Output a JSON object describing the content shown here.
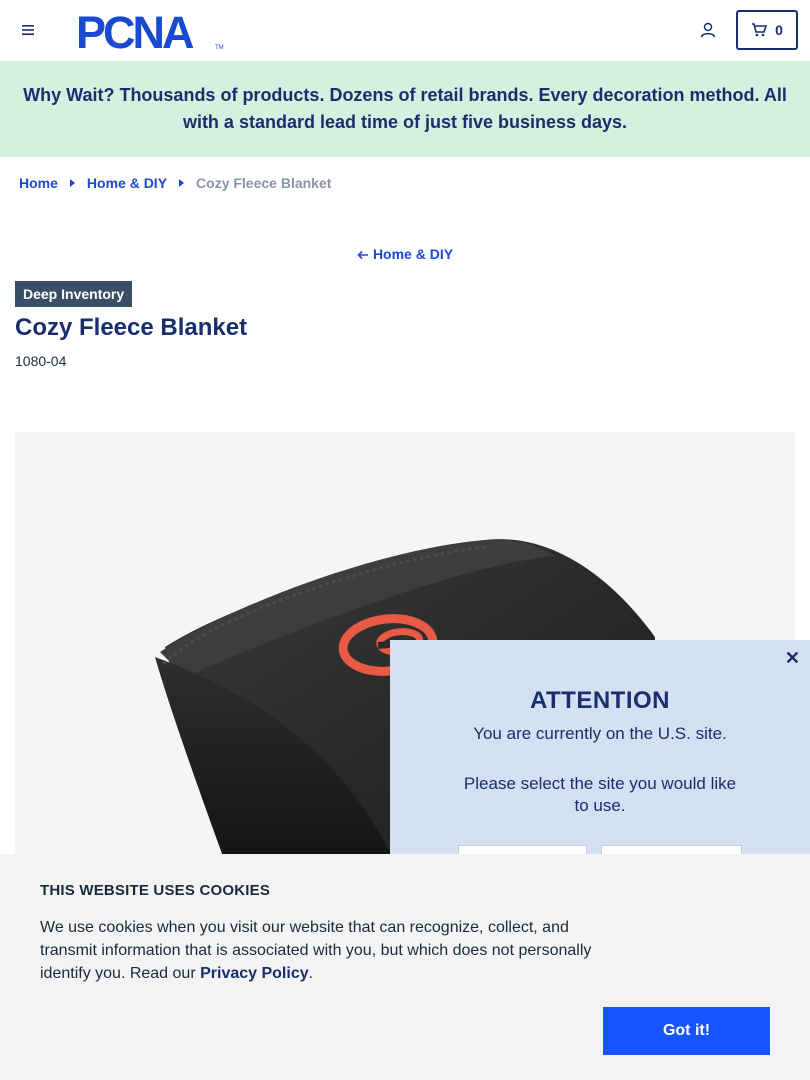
{
  "header": {
    "logo_text": "PCNA",
    "cart_count": "0"
  },
  "promo": {
    "text": "Why Wait? Thousands of products. Dozens of retail brands. Every decoration method. All with a standard lead time of just five business days."
  },
  "breadcrumb": {
    "items": [
      "Home",
      "Home & DIY"
    ],
    "current": "Cozy Fleece Blanket"
  },
  "back_link": "Home & DIY",
  "product": {
    "badge": "Deep Inventory",
    "title": "Cozy Fleece Blanket",
    "sku": "1080-04"
  },
  "attention": {
    "title": "ATTENTION",
    "text1": "You are currently on the U.S. site.",
    "text2": "Please select the site you would like to use."
  },
  "cookie": {
    "title": "THIS WEBSITE USES COOKIES",
    "text": "We use cookies when you visit our website that can recognize, collect, and transmit information that is associated with you, but which does not personally identify you. Read our ",
    "link": "Privacy Policy",
    "text_end": ".",
    "button": "Got it!"
  },
  "colors": {
    "brand_navy": "#1a2e6e",
    "link_blue": "#1a4ad0",
    "promo_bg": "#d4f0de",
    "cta_blue": "#1554ff",
    "modal_bg": "#d4dff2"
  }
}
